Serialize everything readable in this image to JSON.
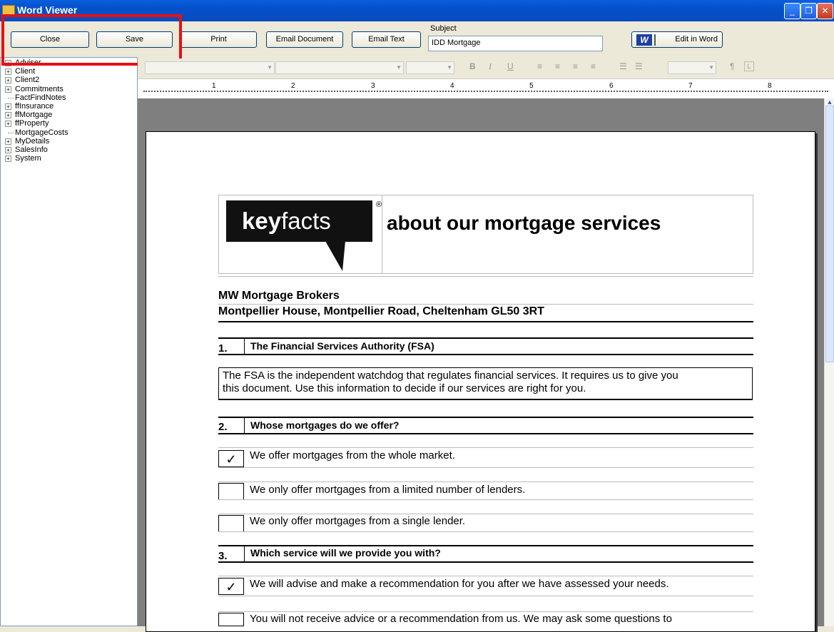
{
  "window": {
    "title": "Word Viewer"
  },
  "toolbar": {
    "close_label": "Close",
    "save_label": "Save",
    "print_label": "Print",
    "email_document_label": "Email Document",
    "email_text_label": "Email Text",
    "subject_label": "Subject",
    "subject_value": "IDD Mortgage",
    "word_icon": "W",
    "edit_in_word_label": "Edit in Word"
  },
  "sidebar": {
    "items": [
      {
        "label": "Adviser",
        "expandable": true
      },
      {
        "label": "Client",
        "expandable": true
      },
      {
        "label": "Client2",
        "expandable": true
      },
      {
        "label": "Commitments",
        "expandable": true
      },
      {
        "label": "FactFindNotes",
        "expandable": false
      },
      {
        "label": "ffInsurance",
        "expandable": true
      },
      {
        "label": "ffMortgage",
        "expandable": true
      },
      {
        "label": "ffProperty",
        "expandable": true
      },
      {
        "label": "MortgageCosts",
        "expandable": false
      },
      {
        "label": "MyDetails",
        "expandable": true
      },
      {
        "label": "SalesInfo",
        "expandable": true
      },
      {
        "label": "System",
        "expandable": true
      }
    ]
  },
  "formatbar": {
    "bold": "B",
    "italic": "I",
    "underline": "U",
    "pilcrow": "¶"
  },
  "ruler": {
    "numbers": [
      "1",
      "2",
      "3",
      "4",
      "5",
      "6",
      "7",
      "8"
    ]
  },
  "document": {
    "logo_key": "key",
    "logo_facts": "facts",
    "logo_reg": "®",
    "heading": "about our mortgage services",
    "firm_name": "MW Mortgage Brokers",
    "firm_address": "Montpellier House, Montpellier Road, Cheltenham GL50 3RT",
    "s1_num": "1.",
    "s1_title": "The Financial Services Authority (FSA)",
    "s1_body_1": "The FSA is the independent watchdog that regulates financial services. It requires us to give you",
    "s1_body_2": "this document. Use this information to decide if our services are right for you.",
    "s2_num": "2.",
    "s2_title": "Whose mortgages do we offer?",
    "s2_opt1": "We offer mortgages from the whole market.",
    "s2_opt2": "We only offer mortgages from a limited number of lenders.",
    "s2_opt3": "We only offer mortgages from a single lender.",
    "s3_num": "3.",
    "s3_title": "Which service will we provide you with?",
    "s3_opt1": "We will advise and make a recommendation for you after we have assessed your needs.",
    "s3_opt2": "You will not receive advice or a recommendation from us. We may ask some questions to",
    "check_mark": "✓"
  }
}
